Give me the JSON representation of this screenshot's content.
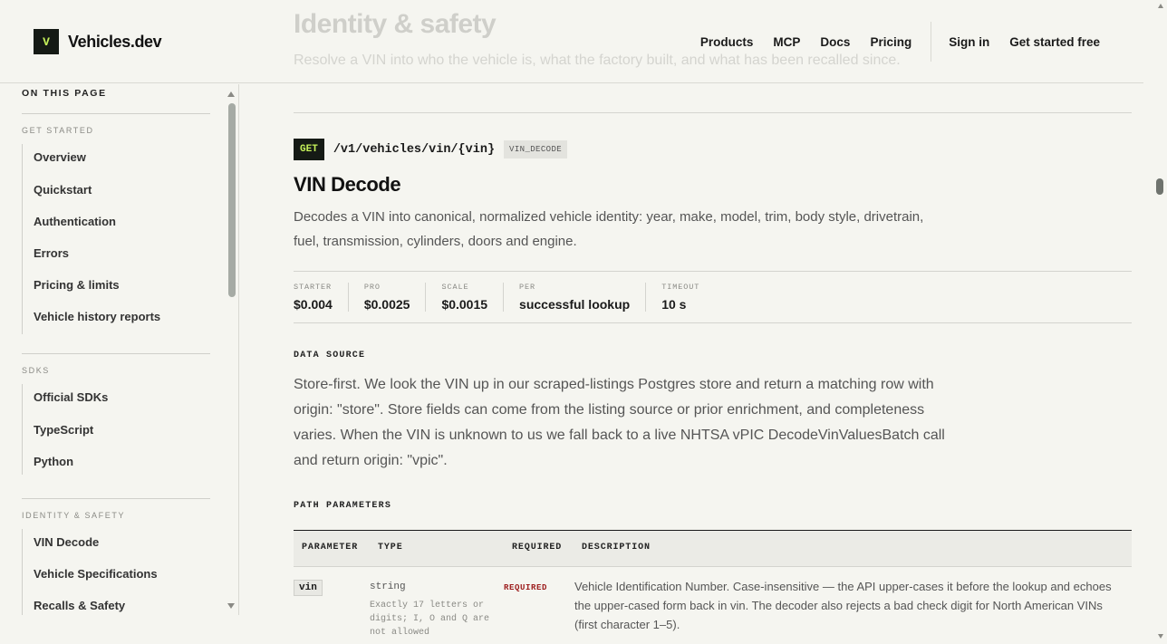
{
  "brand": {
    "logo_letter": "V",
    "name": "Vehicles.dev"
  },
  "nav": {
    "links": [
      "Products",
      "MCP",
      "Docs",
      "Pricing"
    ],
    "sign_in": "Sign in",
    "cta": "Get started free"
  },
  "section_header": {
    "title": "Identity & safety",
    "subtitle": "Resolve a VIN into who the vehicle is, what the factory built, and what has been recalled since."
  },
  "sidebar": {
    "title": "ON THIS PAGE",
    "groups": [
      {
        "title": "GET STARTED",
        "items": [
          "Overview",
          "Quickstart",
          "Authentication",
          "Errors",
          "Pricing & limits",
          "Vehicle history reports"
        ]
      },
      {
        "title": "SDKS",
        "items": [
          "Official SDKs",
          "TypeScript",
          "Python"
        ]
      },
      {
        "title": "IDENTITY & SAFETY",
        "items": [
          "VIN Decode",
          "Vehicle Specifications",
          "Recalls & Safety"
        ]
      }
    ]
  },
  "endpoint": {
    "method": "GET",
    "path": "/v1/vehicles/vin/{vin}",
    "operation": "VIN_DECODE",
    "title": "VIN Decode",
    "description": "Decodes a VIN into canonical, normalized vehicle identity: year, make, model, trim, body style, drivetrain, fuel, transmission, cylinders, doors and engine."
  },
  "pricing": [
    {
      "label": "STARTER",
      "value": "$0.004"
    },
    {
      "label": "PRO",
      "value": "$0.0025"
    },
    {
      "label": "SCALE",
      "value": "$0.0015"
    },
    {
      "label": "PER",
      "value": "successful lookup"
    },
    {
      "label": "TIMEOUT",
      "value": "10 s"
    }
  ],
  "data_source": {
    "label": "DATA SOURCE",
    "text": "Store-first. We look the VIN up in our scraped-listings Postgres store and return a matching row with origin: \"store\". Store fields can come from the listing source or prior enrichment, and completeness varies. When the VIN is unknown to us we fall back to a live NHTSA vPIC DecodeVinValuesBatch call and return origin: \"vpic\"."
  },
  "path_parameters": {
    "label": "PATH PARAMETERS",
    "headers": [
      "PARAMETER",
      "TYPE",
      "REQUIRED",
      "DESCRIPTION"
    ],
    "rows": [
      {
        "name": "vin",
        "type": "string",
        "note": "Exactly 17 letters or digits; I, O and Q are not allowed",
        "required": "REQUIRED",
        "description": "Vehicle Identification Number. Case-insensitive — the API upper-cases it before the lookup and echoes the upper-cased form back in vin. The decoder also rejects a bad check digit for North American VINs (first character 1–5)."
      }
    ]
  },
  "colors": {
    "accent": "#c6f25a",
    "dark": "#151a15",
    "required": "#9b1a1a",
    "background": "#f5f5f0"
  }
}
